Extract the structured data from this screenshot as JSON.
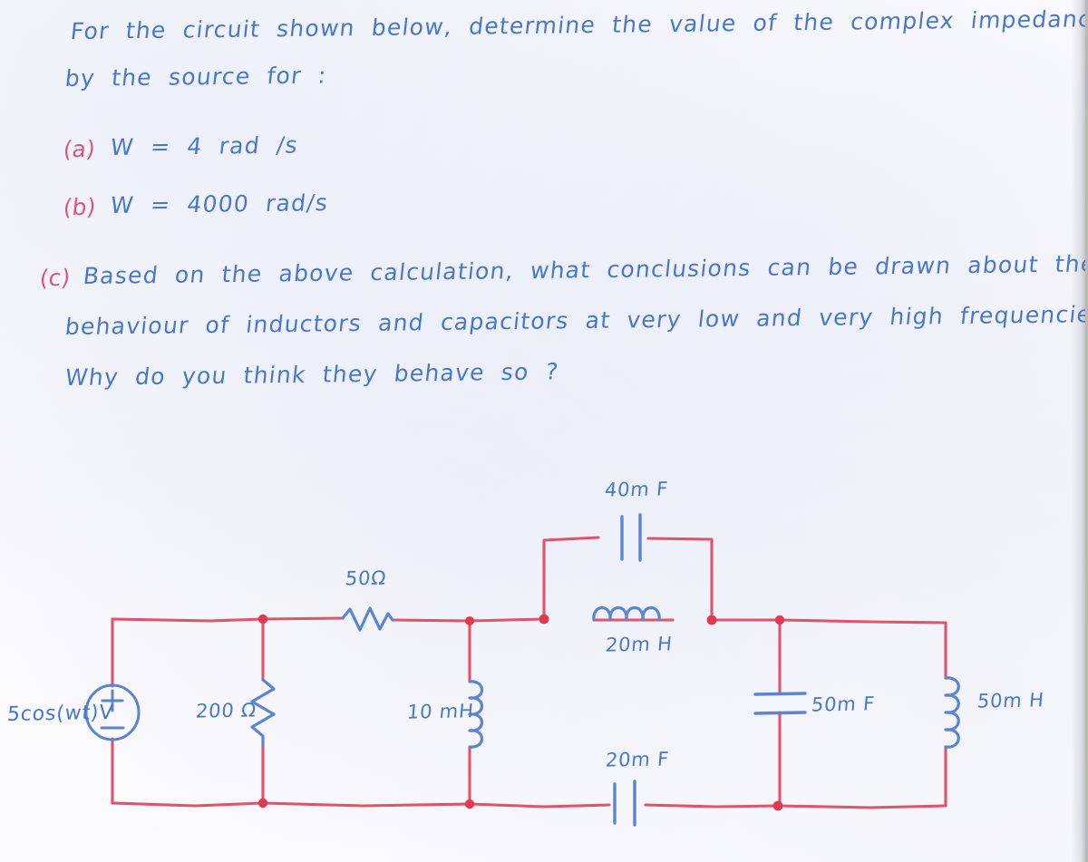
{
  "problem": {
    "statement_lines": [
      "For  the  circuit  shown  below,  determine  the  value  of  the  complex  impedance  seen",
      "by   the   source   for :"
    ],
    "parts": [
      {
        "tag": "(a)",
        "text": "W  =  4  rad /s"
      },
      {
        "tag": "(b)",
        "text": "W  =  4000  rad/s"
      }
    ],
    "part_c": {
      "tag": "(c)",
      "lines": [
        "Based  on  the  above  calculation,  what  conclusions  can  be  drawn  about  the",
        "behaviour  of  inductors  and  capacitors  at  very  low  and  very  high  frequencies ?",
        "Why  do  you  think  they  behave  so  ?"
      ]
    }
  },
  "circuit": {
    "source": {
      "label": "5cos(wt)V",
      "plus_sign": "+",
      "minus_sign": "−"
    },
    "components": [
      {
        "id": "r200",
        "type": "resistor",
        "label": "200 Ω",
        "orientation": "vertical"
      },
      {
        "id": "r50",
        "type": "resistor",
        "label": "50Ω",
        "orientation": "horizontal"
      },
      {
        "id": "l10",
        "type": "inductor",
        "label": "10 mH",
        "orientation": "vertical"
      },
      {
        "id": "c40",
        "type": "capacitor",
        "label": "40m F",
        "orientation": "horizontal"
      },
      {
        "id": "l20",
        "type": "inductor",
        "label": "20m H",
        "orientation": "horizontal"
      },
      {
        "id": "c20",
        "type": "capacitor",
        "label": "20m F",
        "orientation": "horizontal"
      },
      {
        "id": "c50",
        "type": "capacitor",
        "label": "50m F",
        "orientation": "vertical"
      },
      {
        "id": "l50",
        "type": "inductor",
        "label": "50m H",
        "orientation": "vertical"
      }
    ]
  },
  "colors": {
    "ink_blue": "#4a78c8",
    "ink_pink": "#d9577e",
    "wire_red": "#e0536a",
    "component_blue": "#5b85d0",
    "paper": "#fbfafc"
  }
}
